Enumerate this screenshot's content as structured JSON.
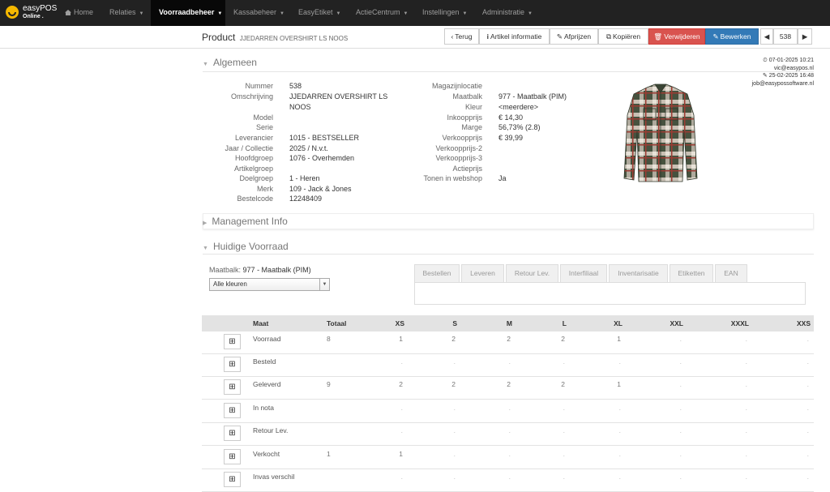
{
  "brand": {
    "name": "easyPOS",
    "sub": "Online ."
  },
  "nav": [
    {
      "label": "Home",
      "icon": "home-icon",
      "active": false
    },
    {
      "label": "Relaties",
      "caret": true
    },
    {
      "label": "Voorraadbeheer",
      "caret": true,
      "active": true
    },
    {
      "label": "Kassabeheer",
      "caret": true
    },
    {
      "label": "EasyEtiket",
      "caret": true
    },
    {
      "label": "ActieCentrum",
      "caret": true
    },
    {
      "label": "Instellingen",
      "caret": true
    },
    {
      "label": "Administratie",
      "caret": true
    }
  ],
  "header": {
    "title": "Product",
    "subtitle": "JJEDARREN OVERSHIRT LS NOOS",
    "buttons": {
      "back": "Terug",
      "info": "Artikel informatie",
      "price": "Afprijzen",
      "copy": "Kopiëren",
      "delete": "Verwijderen",
      "edit": "Bewerken"
    },
    "record_number": "538"
  },
  "sections": {
    "general": "Algemeen",
    "management": "Management Info",
    "stock": "Huidige Voorraad"
  },
  "meta": {
    "created": "07-01-2025 10:21",
    "created_by": "vic@easypos.nl",
    "modified": "25-02-2025 16:48",
    "modified_by": "job@easypossoftware.nl"
  },
  "details_left": [
    {
      "label": "Nummer",
      "value": "538"
    },
    {
      "label": "Omschrijving",
      "value": "JJEDARREN OVERSHIRT LS"
    },
    {
      "label": "",
      "value": "NOOS"
    },
    {
      "label": "Model",
      "value": ""
    },
    {
      "label": "Serie",
      "value": ""
    },
    {
      "label": "Leverancier",
      "value": "1015 - BESTSELLER"
    },
    {
      "label": "Jaar / Collectie",
      "value": "2025 / N.v.t."
    },
    {
      "label": "Hoofdgroep",
      "value": "1076 - Overhemden"
    },
    {
      "label": "Artikelgroep",
      "value": ""
    },
    {
      "label": "Doelgroep",
      "value": "1 - Heren"
    },
    {
      "label": "Merk",
      "value": "109 - Jack & Jones"
    },
    {
      "label": "Bestelcode",
      "value": "12248409"
    }
  ],
  "details_right": [
    {
      "label": "Magazijnlocatie",
      "value": ""
    },
    {
      "label": "Maatbalk",
      "value": "977 - Maatbalk (PIM)"
    },
    {
      "label": "Kleur",
      "value": "<meerdere>"
    },
    {
      "label": "Inkoopprijs",
      "value": "€ 14,30"
    },
    {
      "label": "Marge",
      "value": "56,73% (2.8)"
    },
    {
      "label": "Verkoopprijs",
      "value": "€ 39,99"
    },
    {
      "label": "Verkoopprijs-2",
      "value": ""
    },
    {
      "label": "Verkoopprijs-3",
      "value": ""
    },
    {
      "label": "Actieprijs",
      "value": ""
    },
    {
      "label": "Tonen in webshop",
      "value": "Ja"
    }
  ],
  "stock": {
    "maatbalk_label": "Maatbalk:",
    "maatbalk_value": "977 - Maatbalk (PIM)",
    "color_select": "Alle kleuren",
    "tabs": [
      "Bestellen",
      "Leveren",
      "Retour Lev.",
      "Interfiliaal",
      "Inventarisatie",
      "Etiketten",
      "EAN"
    ],
    "columns": [
      "Maat",
      "Totaal",
      "XS",
      "S",
      "M",
      "L",
      "XL",
      "XXL",
      "XXXL",
      "XXS"
    ],
    "rows": [
      {
        "name": "Voorraad",
        "total": "8",
        "cells": [
          "1",
          "2",
          "2",
          "2",
          "1",
          ".",
          ".",
          "."
        ]
      },
      {
        "name": "Besteld",
        "total": "",
        "cells": [
          ".",
          ".",
          ".",
          ".",
          ".",
          ".",
          ".",
          "."
        ]
      },
      {
        "name": "Geleverd",
        "total": "9",
        "cells": [
          "2",
          "2",
          "2",
          "2",
          "1",
          ".",
          ".",
          "."
        ]
      },
      {
        "name": "In nota",
        "total": "",
        "cells": [
          ".",
          ".",
          ".",
          ".",
          ".",
          ".",
          ".",
          "."
        ]
      },
      {
        "name": "Retour Lev.",
        "total": "",
        "cells": [
          ".",
          ".",
          ".",
          ".",
          ".",
          ".",
          ".",
          "."
        ]
      },
      {
        "name": "Verkocht",
        "total": "1",
        "cells": [
          "1",
          ".",
          ".",
          ".",
          ".",
          ".",
          ".",
          "."
        ]
      },
      {
        "name": "Invas verschil",
        "total": "",
        "cells": [
          ".",
          ".",
          ".",
          ".",
          ".",
          ".",
          ".",
          "."
        ]
      }
    ]
  },
  "colors": {
    "navbar": "#222222",
    "danger": "#d9534f",
    "primary": "#337ab7",
    "brand_yellow": "#f5b800"
  }
}
